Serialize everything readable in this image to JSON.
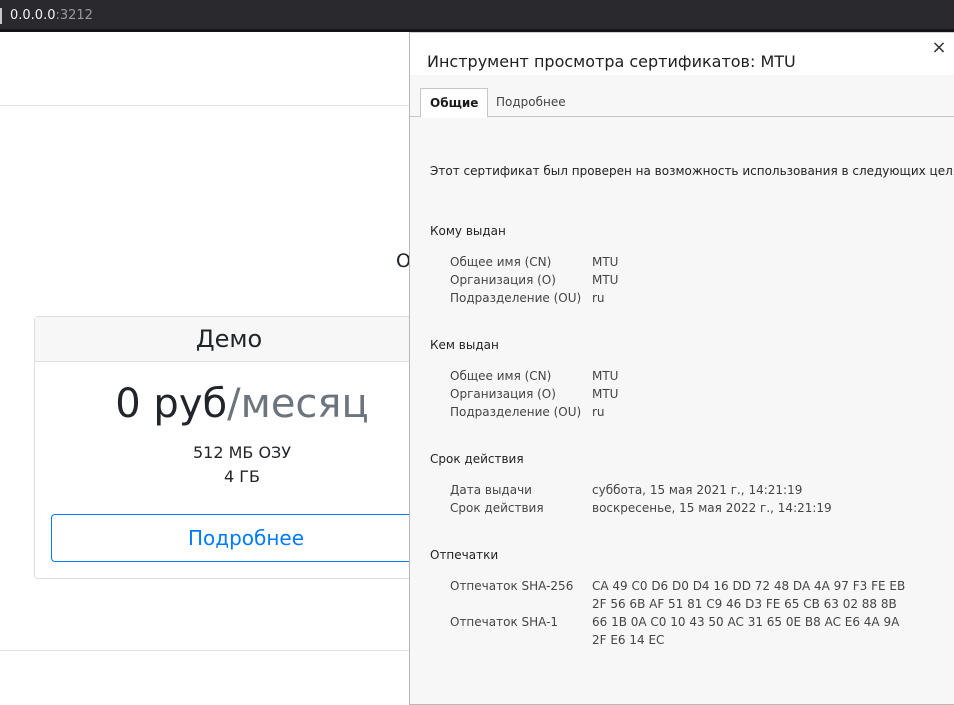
{
  "browser": {
    "url_host": "0.0.0.0",
    "url_port": ":3212"
  },
  "page": {
    "peek_char": "О",
    "card": {
      "title": "Демо",
      "price": "0 руб",
      "period": "/месяц",
      "ram": "512 МБ ОЗУ",
      "disk": "4 ГБ",
      "button": "Подробнее"
    }
  },
  "dialog": {
    "title": "Инструмент просмотра сертификатов: MTU",
    "close": "×",
    "tabs": [
      {
        "label": "Общие",
        "active": true
      },
      {
        "label": "Подробнее",
        "active": false
      }
    ],
    "intro": "Этот сертификат был проверен на возможность использования в следующих целях:",
    "issued_to": {
      "title": "Кому выдан",
      "rows": [
        {
          "label": "Общее имя (CN)",
          "value": "MTU"
        },
        {
          "label": "Организация (O)",
          "value": "MTU"
        },
        {
          "label": "Подразделение (OU)",
          "value": "ru"
        }
      ]
    },
    "issued_by": {
      "title": "Кем выдан",
      "rows": [
        {
          "label": "Общее имя (CN)",
          "value": "MTU"
        },
        {
          "label": "Организация (O)",
          "value": "MTU"
        },
        {
          "label": "Подразделение (OU)",
          "value": "ru"
        }
      ]
    },
    "validity": {
      "title": "Срок действия",
      "rows": [
        {
          "label": "Дата выдачи",
          "value": "суббота, 15 мая 2021 г., 14:21:19"
        },
        {
          "label": "Срок действия",
          "value": "воскресенье, 15 мая 2022 г., 14:21:19"
        }
      ]
    },
    "fingerprints": {
      "title": "Отпечатки",
      "sha256_label": "Отпечаток SHA-256",
      "sha256_line1": "CA 49 C0 D6 D0 D4 16 DD 72 48 DA 4A 97 F3 FE EB",
      "sha256_line2": "2F 56 6B AF 51 81 C9 46 D3 FE 65 CB 63 02 88 8B",
      "sha1_label": "Отпечаток SHA-1",
      "sha1_line1": "66 1B 0A C0 10 43 50 AC 31 65 0E B8 AC E6 4A 9A",
      "sha1_line2": "2F E6 14 EC"
    }
  }
}
